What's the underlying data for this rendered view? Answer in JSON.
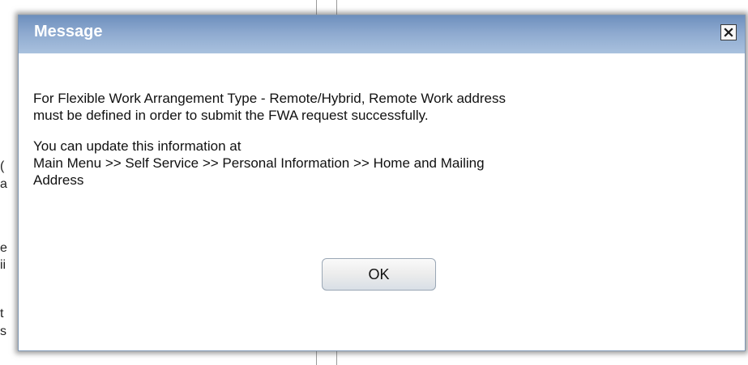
{
  "background": {
    "fragments": [
      "(",
      "a",
      "e",
      "ii",
      "t",
      "s"
    ]
  },
  "dialog": {
    "title": "Message",
    "message_paragraph_1": [
      "For Flexible Work Arrangement Type - Remote/Hybrid, Remote Work address",
      "must be defined in order to submit the FWA request successfully."
    ],
    "message_paragraph_2": [
      "You can update this information at",
      "Main Menu >> Self Service >> Personal Information >> Home and Mailing",
      "Address"
    ],
    "ok_label": "OK",
    "close_icon": "close-icon"
  },
  "colors": {
    "titlebar_top": "#6d8fbd",
    "titlebar_bottom": "#a9c1de",
    "title_text": "#ffffff"
  }
}
